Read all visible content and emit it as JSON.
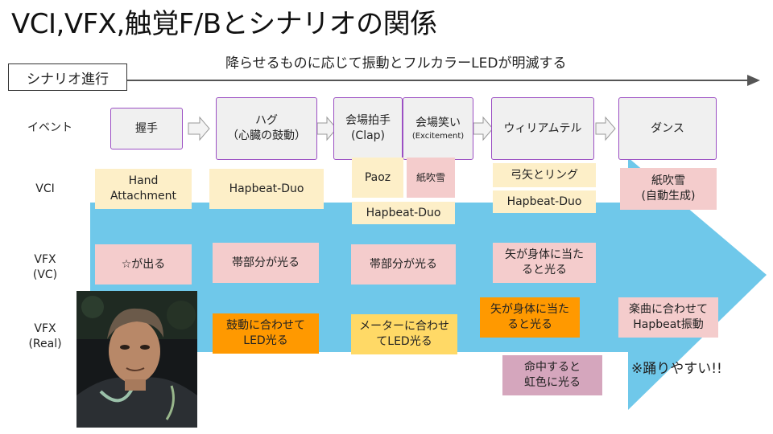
{
  "title": "VCI,VFX,触覚F/Bとシナリオの関係",
  "scenario_label": "シナリオ進行",
  "subtitle": "降らせるものに応じて振動とフルカラーLEDが明滅する",
  "row_labels": {
    "event": "イベント",
    "vci": "VCI",
    "vfx_vc_1": "VFX",
    "vfx_vc_2": "(VC)",
    "vfx_real_1": "VFX",
    "vfx_real_2": "(Real)"
  },
  "events": [
    {
      "line1": "握手",
      "line2": "",
      "small": ""
    },
    {
      "line1": "ハグ",
      "line2": "（心臓の鼓動）",
      "small": ""
    },
    {
      "line1": "会場拍手",
      "line2": "(Clap)",
      "small": ""
    },
    {
      "line1": "会場笑い",
      "line2": "",
      "small": "(Excitement)"
    },
    {
      "line1": "ウィリアムテル",
      "line2": "",
      "small": ""
    },
    {
      "line1": "ダンス",
      "line2": "",
      "small": ""
    }
  ],
  "vci": [
    {
      "line1": "Hand",
      "line2": "Attachment"
    },
    {
      "line1": "Hapbeat-Duo",
      "line2": ""
    },
    {
      "line1": "Paoz",
      "line2": ""
    },
    {
      "line1": "紙吹雪",
      "line2": ""
    },
    {
      "line1": "Hapbeat-Duo",
      "line2": ""
    },
    {
      "line1": "弓矢とリング",
      "line2": ""
    },
    {
      "line1": "Hapbeat-Duo",
      "line2": ""
    },
    {
      "line1": "紙吹雪",
      "line2": "(自動生成)"
    }
  ],
  "vfx_vc": [
    {
      "line1": "☆が出る",
      "line2": ""
    },
    {
      "line1": "帯部分が光る",
      "line2": ""
    },
    {
      "line1": "帯部分が光る",
      "line2": ""
    },
    {
      "line1": "矢が身体に当た",
      "line2": "ると光る"
    }
  ],
  "vfx_real": [
    {
      "line1": "鼓動に合わせて",
      "line2": "LED光る"
    },
    {
      "line1": "メーターに合わせ",
      "line2": "てLED光る"
    },
    {
      "line1": "矢が身体に当た",
      "line2": "ると光る"
    },
    {
      "line1": "命中すると",
      "line2": "虹色に光る"
    },
    {
      "line1": "楽曲に合わせて",
      "line2": "Hapbeat振動"
    }
  ],
  "dance_note": "※踊りやすい!!",
  "colors": {
    "big_arrow": "#6fc8ea",
    "event_border": "#9b4fc3",
    "vci_card": "#fdefc8",
    "vfx_card": "#f4cccc",
    "real_led": "#ff9900",
    "real_meter": "#ffd966",
    "rainbow": "#d5a6bd"
  }
}
